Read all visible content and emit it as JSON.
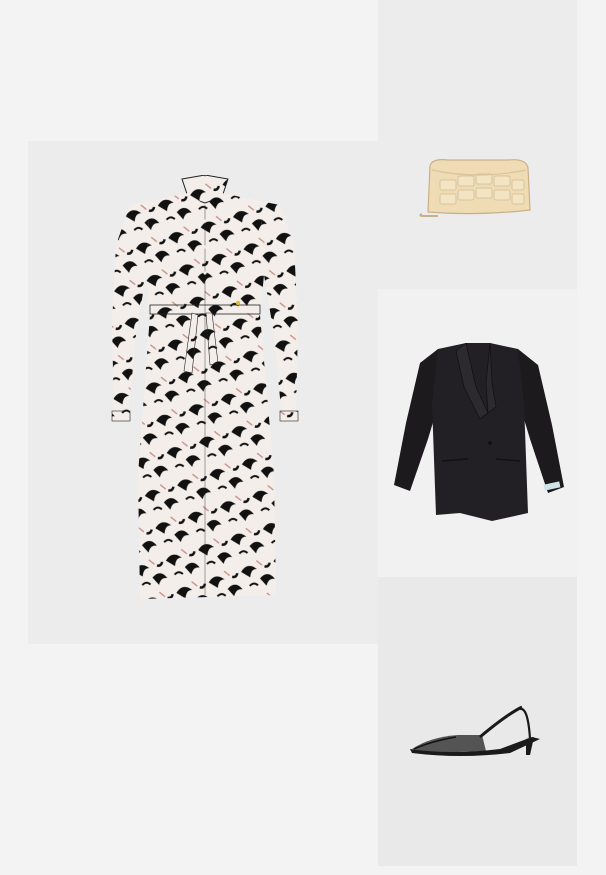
{
  "outfit": {
    "items": [
      {
        "product": "dress",
        "icon": "shirt-dress-icon",
        "colors": [
          "#111111",
          "#f4eeea",
          "#c98b86"
        ]
      },
      {
        "product": "bag",
        "icon": "clutch-bag-icon",
        "colors": [
          "#efdcb4",
          "#c9b08a"
        ]
      },
      {
        "product": "blazer",
        "icon": "blazer-icon",
        "colors": [
          "#1c1a1c",
          "#cfe3e8"
        ]
      },
      {
        "product": "shoe",
        "icon": "slingback-shoe-icon",
        "colors": [
          "#1a1a1a",
          "#3a3a3a"
        ]
      }
    ]
  }
}
